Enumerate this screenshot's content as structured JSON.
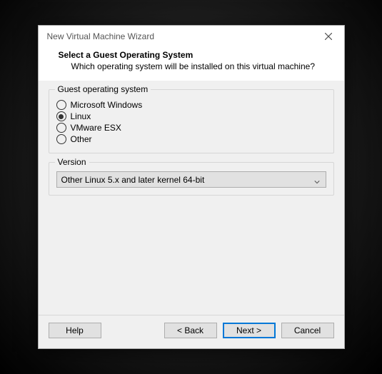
{
  "window": {
    "title": "New Virtual Machine Wizard"
  },
  "header": {
    "title": "Select a Guest Operating System",
    "subtitle": "Which operating system will be installed on this virtual machine?"
  },
  "guest_os": {
    "group_label": "Guest operating system",
    "options": {
      "windows": "Microsoft Windows",
      "linux": "Linux",
      "esx": "VMware ESX",
      "other": "Other"
    },
    "selected": "linux"
  },
  "version": {
    "group_label": "Version",
    "selected": "Other Linux 5.x and later kernel 64-bit"
  },
  "buttons": {
    "help": "Help",
    "back": "< Back",
    "next": "Next >",
    "cancel": "Cancel"
  }
}
